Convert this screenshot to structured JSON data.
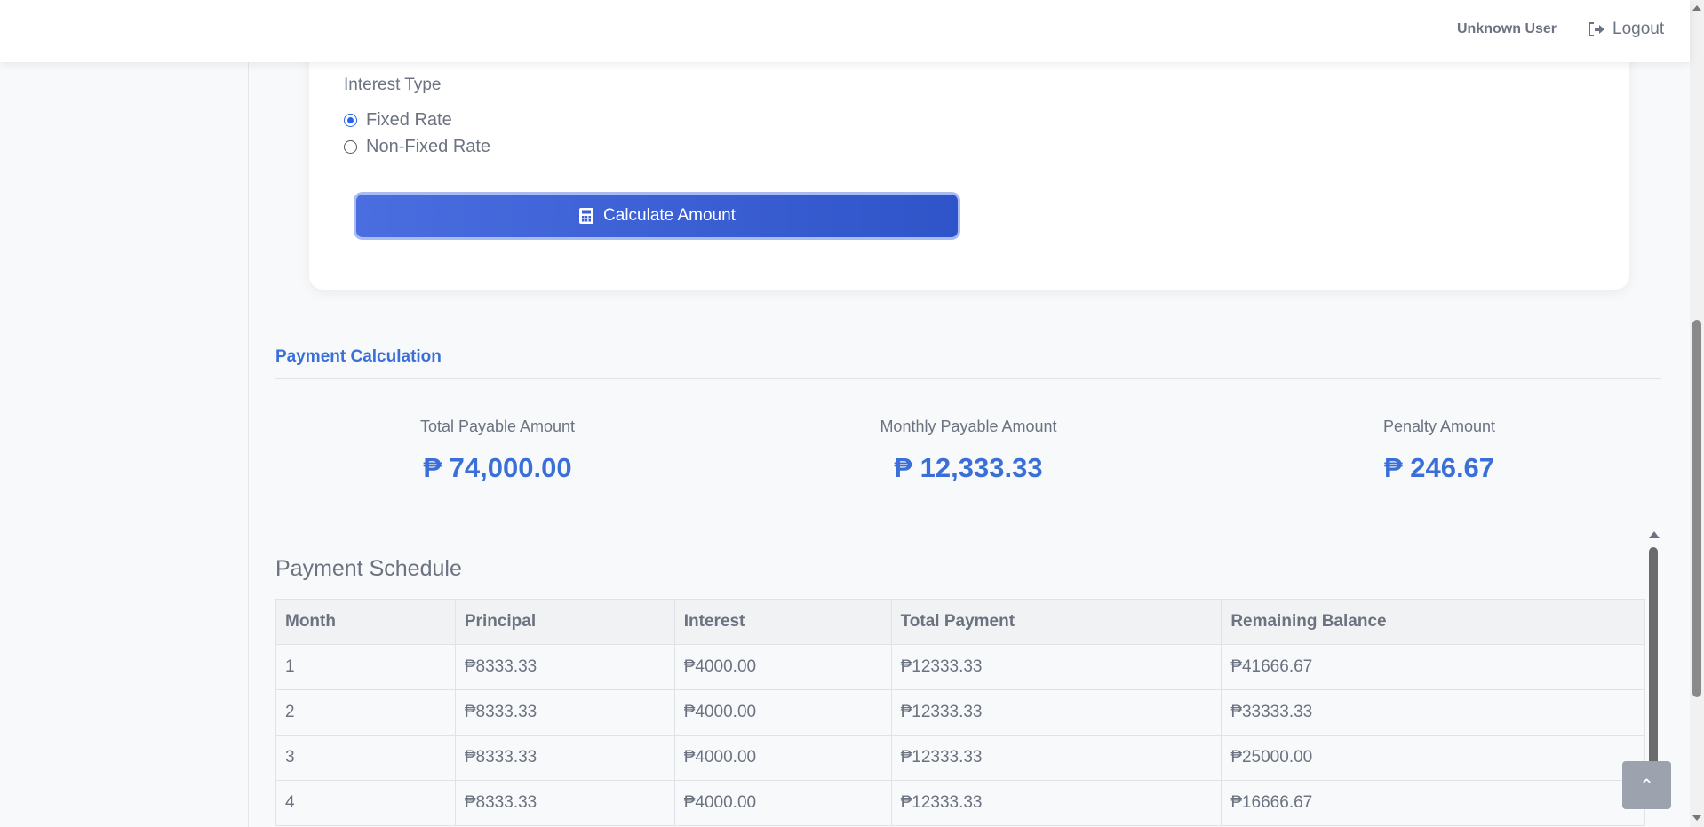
{
  "header": {
    "user_name": "Unknown User",
    "logout_label": "Logout"
  },
  "form": {
    "interest_type_label": "Interest Type",
    "options": [
      {
        "label": "Fixed Rate",
        "checked": true
      },
      {
        "label": "Non-Fixed Rate",
        "checked": false
      }
    ],
    "calculate_button_label": "Calculate Amount"
  },
  "payment_calculation": {
    "title": "Payment Calculation",
    "stats": [
      {
        "label": "Total Payable Amount",
        "value": "₱ 74,000.00"
      },
      {
        "label": "Monthly Payable Amount",
        "value": "₱ 12,333.33"
      },
      {
        "label": "Penalty Amount",
        "value": "₱ 246.67"
      }
    ]
  },
  "schedule": {
    "title": "Payment Schedule",
    "columns": [
      "Month",
      "Principal",
      "Interest",
      "Total Payment",
      "Remaining Balance"
    ],
    "rows": [
      [
        "1",
        "₱8333.33",
        "₱4000.00",
        "₱12333.33",
        "₱41666.67"
      ],
      [
        "2",
        "₱8333.33",
        "₱4000.00",
        "₱12333.33",
        "₱33333.33"
      ],
      [
        "3",
        "₱8333.33",
        "₱4000.00",
        "₱12333.33",
        "₱25000.00"
      ],
      [
        "4",
        "₱8333.33",
        "₱4000.00",
        "₱12333.33",
        "₱16666.67"
      ]
    ]
  },
  "colors": {
    "accent": "#3b6fd8",
    "button": "#3a5fd6",
    "text": "#6b7280"
  },
  "icons": {
    "logout": "sign-out-icon",
    "calculate": "calculator-icon",
    "back_to_top": "chevron-up-icon"
  }
}
